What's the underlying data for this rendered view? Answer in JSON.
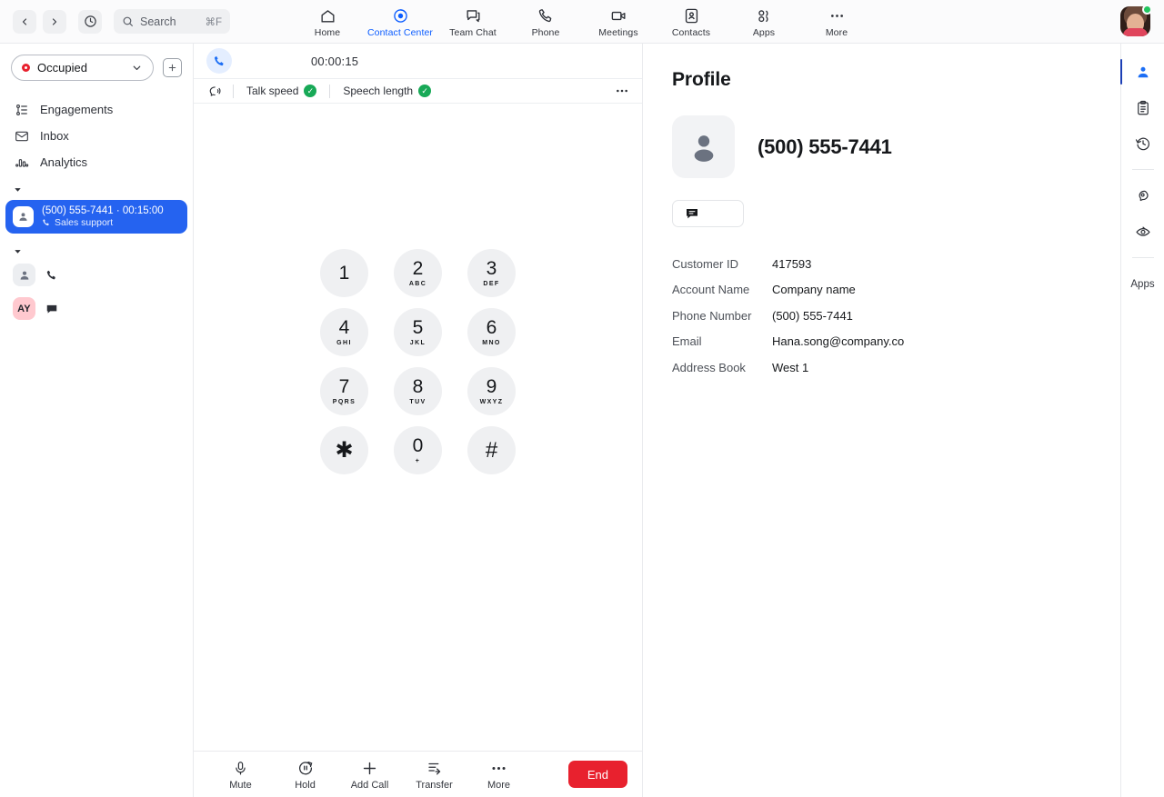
{
  "topbar": {
    "back_icon": "chevron-left-icon",
    "forward_icon": "chevron-right-icon",
    "history_icon": "clock-history-icon",
    "search": {
      "placeholder": "Search",
      "shortcut": "⌘F"
    },
    "nav": [
      {
        "label": "Home",
        "icon": "home-icon",
        "active": false
      },
      {
        "label": "Contact Center",
        "icon": "contact-center-icon",
        "active": true
      },
      {
        "label": "Team Chat",
        "icon": "team-chat-icon",
        "active": false
      },
      {
        "label": "Phone",
        "icon": "phone-icon",
        "active": false
      },
      {
        "label": "Meetings",
        "icon": "video-camera-icon",
        "active": false
      },
      {
        "label": "Contacts",
        "icon": "contacts-icon",
        "active": false
      },
      {
        "label": "Apps",
        "icon": "apps-icon",
        "active": false
      },
      {
        "label": "More",
        "icon": "more-horizontal-icon",
        "active": false
      }
    ],
    "accent_color": "#0b5cff",
    "avatar_status": "online"
  },
  "sidebar": {
    "status": {
      "label": "Occupied",
      "color": "#e8212e"
    },
    "add_button_icon": "plus-square-icon",
    "items": [
      {
        "label": "Engagements",
        "icon": "engagements-icon"
      },
      {
        "label": "Inbox",
        "icon": "inbox-icon"
      },
      {
        "label": "Analytics",
        "icon": "analytics-icon"
      }
    ],
    "active_call": {
      "title": "(500) 555-7441 · 00:15:00",
      "subtitle": "Sales support",
      "icon": "phone-icon",
      "avatar_icon": "person-icon",
      "highlight_color": "#2563f0"
    },
    "queue_items": [
      {
        "avatar": "person-icon",
        "avatar_kind": "gray",
        "channel_icon": "phone-icon"
      },
      {
        "avatar": "AY",
        "avatar_kind": "pink",
        "channel_icon": "chat-icon"
      }
    ]
  },
  "call": {
    "icon": "phone-active-icon",
    "timer": "00:00:15",
    "coach_icon": "speaking-head-icon",
    "metrics": [
      {
        "label": "Talk speed",
        "status": "good",
        "status_icon": "check-circle-icon"
      },
      {
        "label": "Speech length",
        "status": "good",
        "status_icon": "check-circle-icon"
      }
    ],
    "metrics_more_icon": "more-horizontal-icon",
    "good_color": "#18a957",
    "dialpad": [
      {
        "num": "1",
        "sub": ""
      },
      {
        "num": "2",
        "sub": "ABC"
      },
      {
        "num": "3",
        "sub": "DEF"
      },
      {
        "num": "4",
        "sub": "GHI"
      },
      {
        "num": "5",
        "sub": "JKL"
      },
      {
        "num": "6",
        "sub": "MNO"
      },
      {
        "num": "7",
        "sub": "PQRS"
      },
      {
        "num": "8",
        "sub": "TUV"
      },
      {
        "num": "9",
        "sub": "WXYZ"
      },
      {
        "num": "✱",
        "sub": ""
      },
      {
        "num": "0",
        "sub": "+"
      },
      {
        "num": "#",
        "sub": ""
      }
    ],
    "actions": [
      {
        "label": "Mute",
        "icon": "microphone-icon"
      },
      {
        "label": "Hold",
        "icon": "pause-circle-icon"
      },
      {
        "label": "Add Call",
        "icon": "plus-icon"
      },
      {
        "label": "Transfer",
        "icon": "transfer-icon"
      },
      {
        "label": "More",
        "icon": "more-horizontal-icon"
      }
    ],
    "end_label": "End",
    "end_color": "#e8212e"
  },
  "profile": {
    "title": "Profile",
    "avatar_icon": "person-icon",
    "phone": "(500) 555-7441",
    "sms_button_icon": "chat-bubble-icon",
    "fields": [
      {
        "key": "Customer ID",
        "value": "417593"
      },
      {
        "key": "Account Name",
        "value": "Company name"
      },
      {
        "key": "Phone Number",
        "value": "(500) 555-7441"
      },
      {
        "key": "Email",
        "value": "Hana.song@company.co"
      },
      {
        "key": "Address Book",
        "value": "West 1"
      }
    ]
  },
  "right_rail": {
    "items": [
      {
        "icon": "person-icon",
        "active": true
      },
      {
        "icon": "clipboard-icon",
        "active": false
      },
      {
        "icon": "clock-history-icon",
        "active": false
      },
      {
        "icon": "head-insight-icon",
        "active": false
      },
      {
        "icon": "eye-view-icon",
        "active": false
      }
    ],
    "apps_label": "Apps"
  }
}
